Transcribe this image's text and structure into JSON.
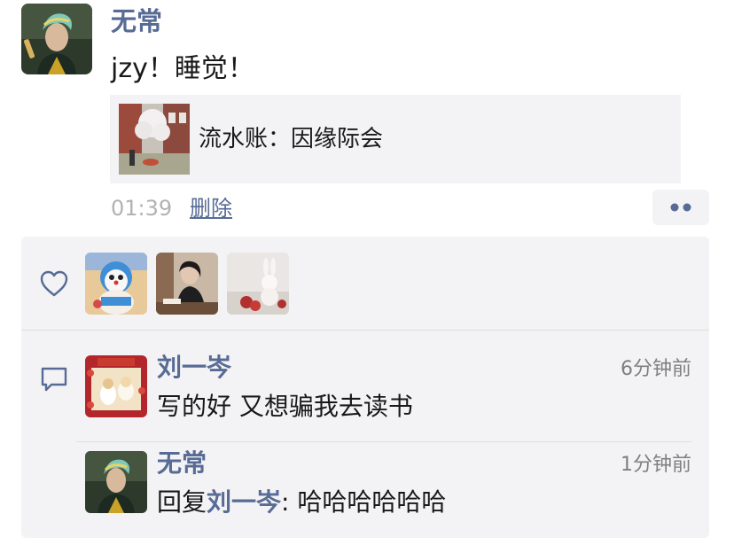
{
  "post": {
    "author": "无常",
    "text": "jzy！睡觉！",
    "shared_link": {
      "title": "流水账：因缘际会"
    },
    "time": "01:39",
    "delete_label": "删除"
  },
  "likes": {
    "icon": "heart-icon",
    "users": [
      "doraemon-bear-avatar",
      "woman-desk-avatar",
      "rabbit-doll-avatar"
    ]
  },
  "comments": [
    {
      "author": "刘一岑",
      "time": "6分钟前",
      "text": "写的好 又想骗我去读书"
    },
    {
      "author": "无常",
      "time": "1分钟前",
      "reply_label": "回复",
      "reply_to": "刘一岑",
      "reply_separator": ": ",
      "text": "哈哈哈哈哈哈"
    }
  ],
  "colors": {
    "name_blue": "#576b95",
    "panel_bg": "#f3f3f5",
    "time_gray": "#b2b2b2"
  }
}
